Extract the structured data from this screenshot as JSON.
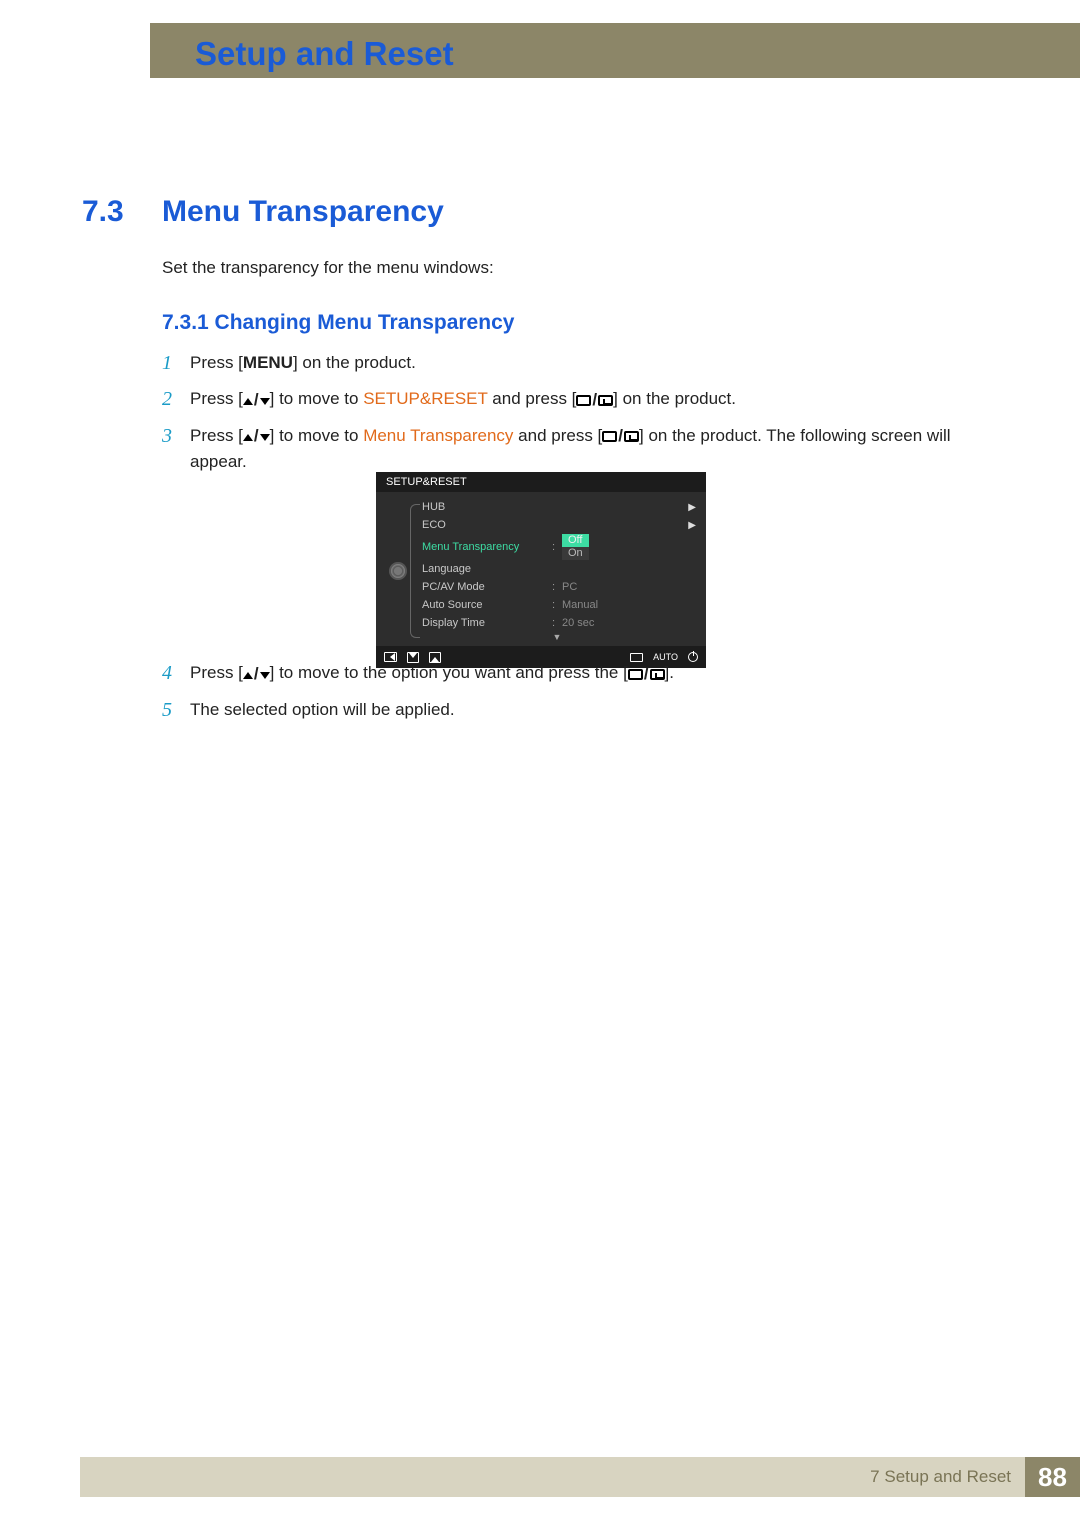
{
  "header": {
    "chapter_title": "Setup and Reset"
  },
  "section": {
    "number": "7.3",
    "title": "Menu Transparency"
  },
  "intro": "Set the transparency for the menu windows:",
  "subsection": {
    "label": "7.3.1  Changing Menu Transparency"
  },
  "buttons": {
    "menu": "MENU"
  },
  "terms": {
    "setup_reset": "SETUP&RESET",
    "menu_transparency": "Menu Transparency"
  },
  "steps": {
    "s1": {
      "num": "1",
      "pre": "Press [",
      "post": "] on the product."
    },
    "s2": {
      "num": "2",
      "pre": "Press [",
      "mid1": "] to move to ",
      "mid2": " and press [",
      "post": "] on the product."
    },
    "s3": {
      "num": "3",
      "pre": "Press [",
      "mid1": "] to move to ",
      "mid2": " and press [",
      "post": "] on the product. The following screen will appear."
    },
    "s4": {
      "num": "4",
      "pre": "Press [",
      "mid1": "] to move to the option you want and press the [",
      "post": "]."
    },
    "s5": {
      "num": "5",
      "text": "The selected option will be applied."
    }
  },
  "osd": {
    "title": "SETUP&RESET",
    "rows": {
      "hub": "HUB",
      "eco": "ECO",
      "menu_transparency": "Menu Transparency",
      "language": "Language",
      "pcav": "PC/AV Mode",
      "auto_source": "Auto Source",
      "display_time": "Display Time"
    },
    "values": {
      "pcav": "PC",
      "auto_source": "Manual",
      "display_time": "20 sec"
    },
    "options": {
      "off": "Off",
      "on": "On"
    },
    "footer_auto": "AUTO"
  },
  "footer": {
    "chapter": "7 Setup and Reset",
    "page": "88"
  }
}
